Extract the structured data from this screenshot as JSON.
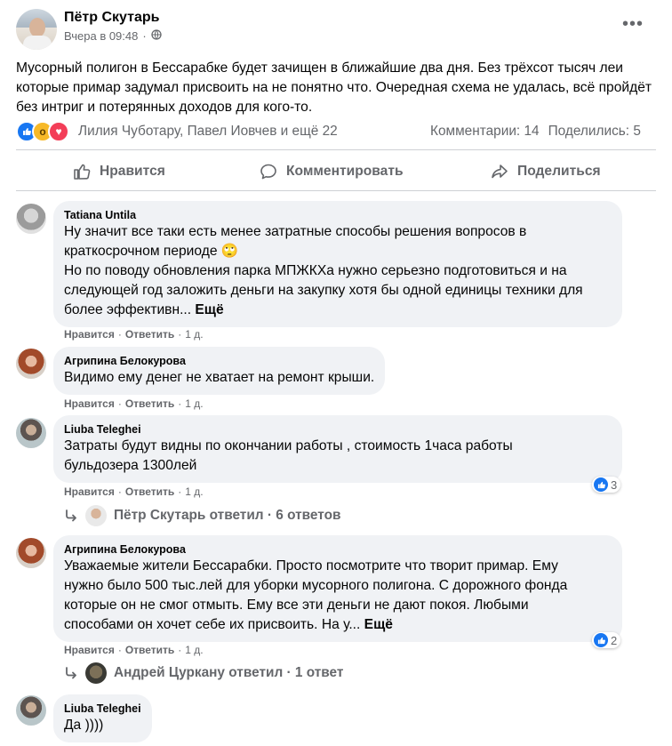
{
  "post": {
    "author": "Пётр Скутарь",
    "time": "Вчера в 09:48",
    "privacy_dot": "·",
    "text": "Мусорный полигон в Бессарабке будет зачищен в ближайшие два дня. Без трёхсот тысяч леи которые примар задумал присвоить на не понятно что. Очередная схема не удалась, всё пройдёт без интриг и потерянных доходов для кого-то.",
    "reaction_icons": [
      "like-icon",
      "wow-icon",
      "love-icon"
    ],
    "reaction_names": "Лилия Чуботару, Павел Иовчев и ещё 22",
    "comments_count": "Комментарии: 14",
    "shares_count": "Поделились: 5"
  },
  "actions": {
    "like": "Нравится",
    "comment": "Комментировать",
    "share": "Поделиться"
  },
  "comments": [
    {
      "name": "Tatiana Untila",
      "lines": [
        "Ну значит все таки есть менее затратные способы решения вопросов в",
        "краткосрочном периоде 🙄",
        "Но по поводу обновления парка МПЖКХа нужно серьезно подготовиться и на",
        "следующей год заложить деньги на закупку хотя бы одной единицы техники для",
        "более эффективн... "
      ],
      "more": "Ещё",
      "like": "Нравится",
      "reply": "Ответить",
      "time": "1 д."
    },
    {
      "name": "Агрипина Белокурова",
      "lines": [
        "Видимо ему денег не хватает на ремонт крыши."
      ],
      "like": "Нравится",
      "reply": "Ответить",
      "time": "1 д."
    },
    {
      "name": "Liuba Teleghei",
      "lines": [
        "Затраты будут видны по окончании работы , стоимость 1часа работы",
        "бульдозера 1300лей"
      ],
      "like": "Нравится",
      "reply": "Ответить",
      "time": "1 д.",
      "reactions": "3",
      "replies_label": "Пётр Скутарь ответил · 6 ответов"
    },
    {
      "name": "Агрипина Белокурова",
      "lines": [
        "Уважаемые жители Бессарабки. Просто посмотрите что творит примар. Ему",
        "нужно было 500 тыс.лей для уборки мусорного полигона. С дорожного фонда",
        "которые он не смог отмыть. Ему все эти деньги не дают покоя. Любыми",
        "способами он хочет себе их присвоить. На у... "
      ],
      "more": "Ещё",
      "like": "Нравится",
      "reply": "Ответить",
      "time": "1 д.",
      "reactions": "2",
      "replies_label": "Андрей Цуркану ответил · 1 ответ"
    },
    {
      "name": "Liuba Teleghei",
      "lines": [
        "Да ))))"
      ]
    }
  ],
  "colors": {
    "secondary_text": "#65676b",
    "bubble": "#f0f2f5",
    "like_blue": "#1877f2"
  }
}
